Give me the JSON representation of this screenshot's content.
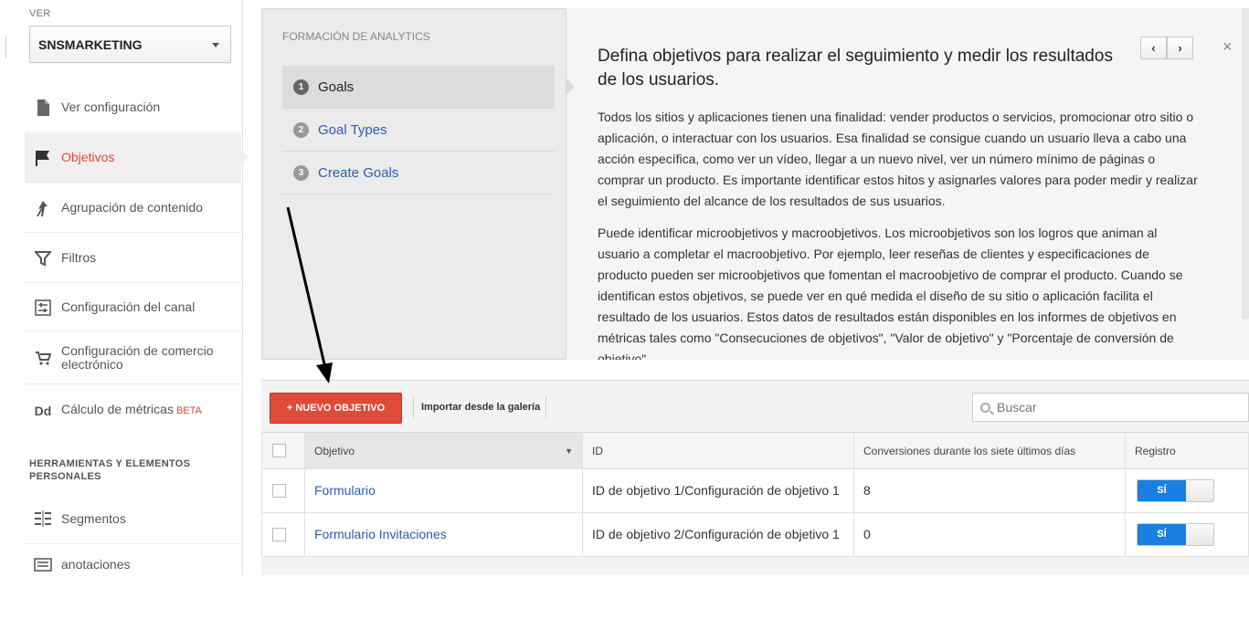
{
  "sidebar": {
    "view_label": "VER",
    "view_value": "SNSMARKETING",
    "items": [
      {
        "label": "Ver configuración",
        "icon": "document-icon"
      },
      {
        "label": "Objetivos",
        "icon": "flag-icon"
      },
      {
        "label": "Agrupación de contenido",
        "icon": "person-walking-icon"
      },
      {
        "label": "Filtros",
        "icon": "filter-icon"
      },
      {
        "label": "Configuración del canal",
        "icon": "channel-settings-icon"
      },
      {
        "label": "Configuración de comercio electrónico",
        "icon": "cart-icon"
      },
      {
        "label": "Cálculo de métricas",
        "badge": "BETA",
        "icon": "dd-icon",
        "icon_text": "Dd"
      }
    ],
    "section_title": "HERRAMIENTAS Y ELEMENTOS PERSONALES",
    "tools": [
      {
        "label": "Segmentos",
        "icon": "segments-icon"
      },
      {
        "label": "anotaciones",
        "icon": "annotation-icon"
      }
    ]
  },
  "training": {
    "title": "FORMACIÓN DE ANALYTICS",
    "steps": [
      {
        "num": "1",
        "label": "Goals"
      },
      {
        "num": "2",
        "label": "Goal Types"
      },
      {
        "num": "3",
        "label": "Create Goals"
      }
    ],
    "heading": "Defina objetivos para realizar el seguimiento y medir los resultados de los usuarios.",
    "paragraphs": [
      "Todos los sitios y aplicaciones tienen una finalidad: vender productos o servicios, promocionar otro sitio o aplicación, o interactuar con los usuarios. Esa finalidad se consigue cuando un usuario lleva a cabo una acción específica, como ver un vídeo, llegar a un nuevo nivel, ver un número mínimo de páginas o comprar un producto. Es importante identificar estos hitos y asignarles valores para poder medir y realizar el seguimiento del alcance de los resultados de sus usuarios.",
      "Puede identificar microobjetivos y macroobjetivos. Los microobjetivos son los logros que animan al usuario a completar el macroobjetivo. Por ejemplo, leer reseñas de clientes y especificaciones de producto pueden ser microobjetivos que fomentan el macroobjetivo de comprar el producto. Cuando se identifican estos objetivos, se puede ver en qué medida el diseño de su sitio o aplicación facilita el resultado de los usuarios. Estos datos de resultados están disponibles en los informes de objetivos en métricas tales como \"Consecuciones de objetivos\", \"Valor de objetivo\" y \"Porcentaje de conversión de objetivo\"."
    ],
    "prev": "‹",
    "next": "›",
    "close": "×"
  },
  "goals": {
    "new_button": "+ NUEVO OBJETIVO",
    "import_link": "Importar desde la galería",
    "search_placeholder": "Buscar",
    "columns": {
      "objetivo": "Objetivo",
      "id": "ID",
      "conversions": "Conversiones durante los siete últimos días",
      "registro": "Registro"
    },
    "rows": [
      {
        "name": "Formulario",
        "id": "ID de objetivo 1/Configuración de objetivo 1",
        "conversions": "8",
        "toggle": "SÍ"
      },
      {
        "name": "Formulario Invitaciones",
        "id": "ID de objetivo 2/Configuración de objetivo 1",
        "conversions": "0",
        "toggle": "SÍ"
      }
    ]
  }
}
